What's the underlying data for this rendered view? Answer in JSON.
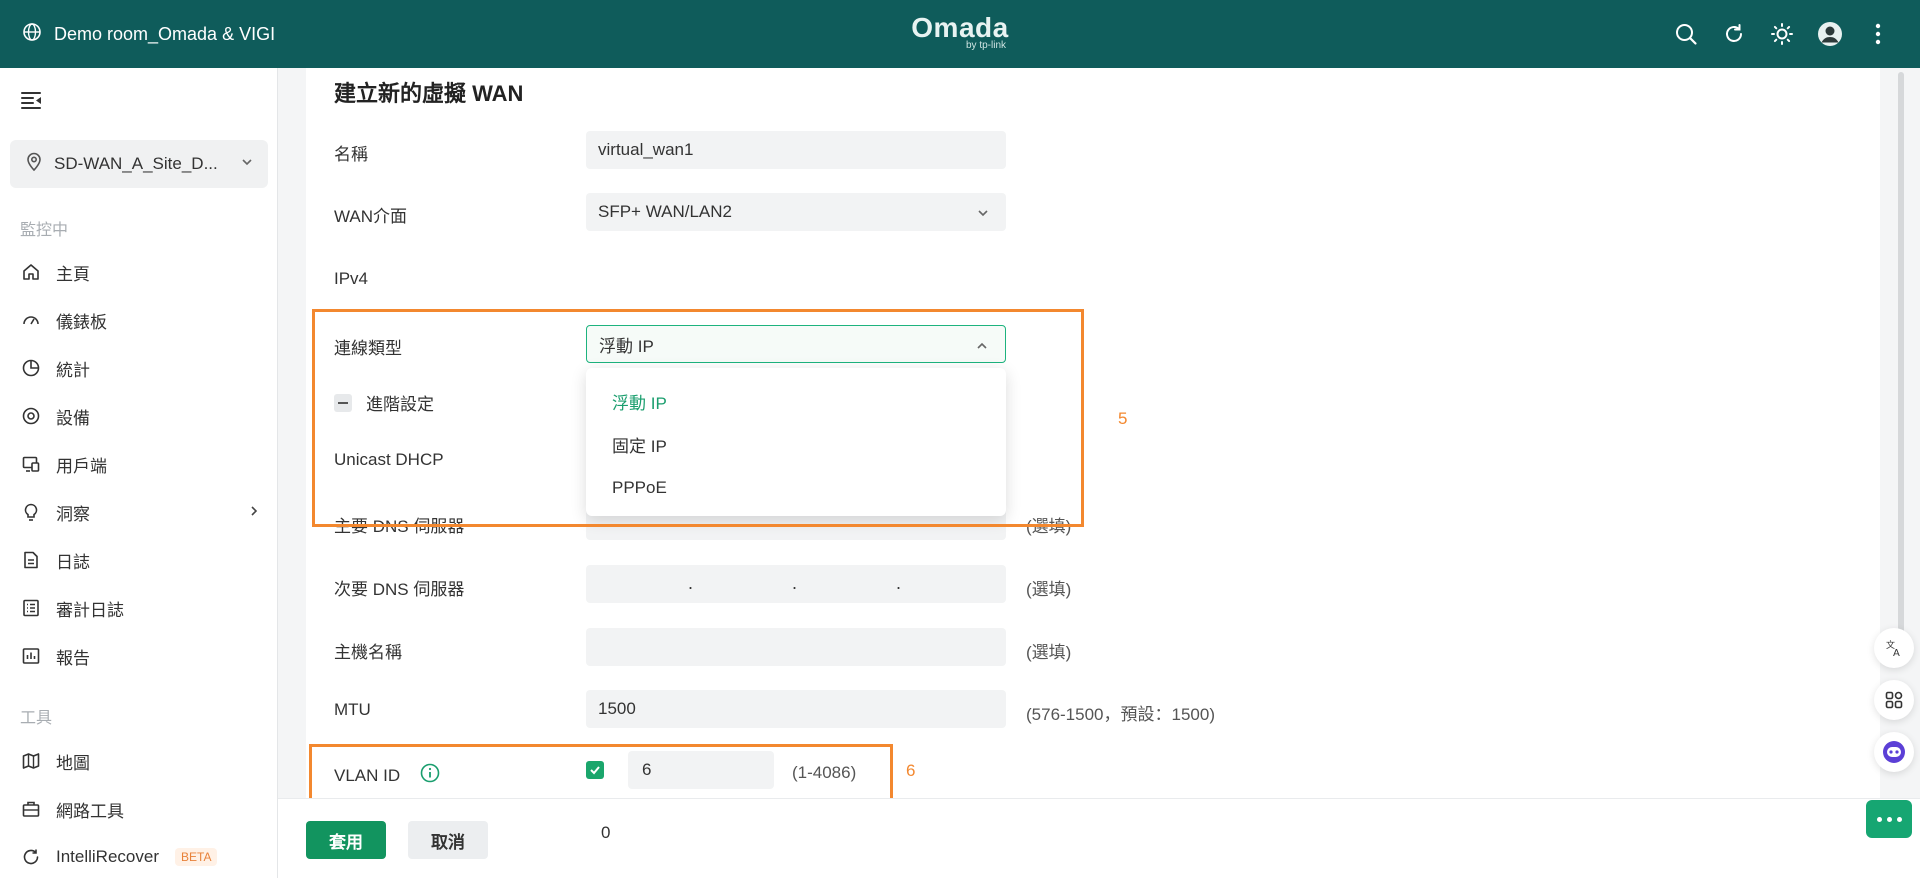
{
  "header": {
    "site_name": "Demo room_Omada & VIGI",
    "brand": "Omada",
    "brand_sub": "by tp-link",
    "icons": [
      "globe-icon",
      "search-icon",
      "refresh-icon",
      "theme-icon",
      "user-avatar",
      "more-icon"
    ]
  },
  "sidebar": {
    "site_selector": "SD-WAN_A_Site_D...",
    "group_monitor": "監控中",
    "items": [
      {
        "label": "主頁",
        "icon": "home-icon"
      },
      {
        "label": "儀錶板",
        "icon": "dashboard-icon"
      },
      {
        "label": "統計",
        "icon": "statistics-icon"
      },
      {
        "label": "設備",
        "icon": "devices-icon"
      },
      {
        "label": "用戶端",
        "icon": "clients-icon"
      },
      {
        "label": "洞察",
        "icon": "insight-icon"
      },
      {
        "label": "日誌",
        "icon": "log-icon"
      },
      {
        "label": "審計日誌",
        "icon": "audit-log-icon"
      },
      {
        "label": "報告",
        "icon": "report-icon"
      }
    ],
    "group_tools": "工具",
    "tools": [
      {
        "label": "地圖",
        "icon": "map-icon"
      },
      {
        "label": "網路工具",
        "icon": "network-tools-icon"
      },
      {
        "label": "IntelliRecover",
        "icon": "intellirecover-icon",
        "badge": "BETA"
      }
    ]
  },
  "form": {
    "title": "建立新的虛擬 WAN",
    "name_label": "名稱",
    "name_value": "virtual_wan1",
    "wan_label": "WAN介面",
    "wan_value": "SFP+ WAN/LAN2",
    "ipv4_label": "IPv4",
    "conn_type_label": "連線類型",
    "conn_type_value": "浮動 IP",
    "conn_options": [
      "浮動 IP",
      "固定 IP",
      "PPPoE"
    ],
    "advanced_label": "進階設定",
    "unicast_label": "Unicast DHCP",
    "primary_dns_label": "主要 DNS 伺服器",
    "primary_dns_hint": "(選填)",
    "secondary_dns_label": "次要 DNS 伺服器",
    "secondary_dns_hint": "(選填)",
    "hostname_label": "主機名稱",
    "hostname_hint": "(選填)",
    "mtu_label": "MTU",
    "mtu_value": "1500",
    "mtu_hint": "(576-1500，預設：1500)",
    "vlan_label": "VLAN ID",
    "vlan_value": "6",
    "vlan_hint": "(1-4086)",
    "vlan_checked": true
  },
  "annotations": {
    "box1_label": "5",
    "box2_label": "6"
  },
  "footer": {
    "apply": "套用",
    "cancel": "取消",
    "value": "0"
  },
  "colors": {
    "topbar": "#0f5c5b",
    "accent": "#12945f",
    "highlight": "#f3882f"
  }
}
